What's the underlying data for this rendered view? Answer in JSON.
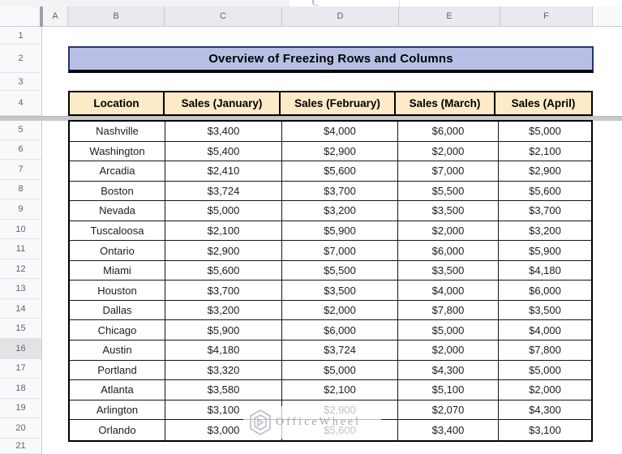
{
  "sheet": {
    "column_headers": [
      "A",
      "B",
      "C",
      "D",
      "E",
      "F"
    ],
    "row_numbers": [
      "1",
      "2",
      "3",
      "4",
      "5",
      "6",
      "7",
      "8",
      "9",
      "10",
      "11",
      "12",
      "13",
      "14",
      "15",
      "16",
      "17",
      "18",
      "19",
      "20",
      "21"
    ],
    "active_row": "16",
    "title": "Overview of Freezing Rows and Columns",
    "table": {
      "headers": [
        "Location",
        "Sales (January)",
        "Sales (February)",
        "Sales (March)",
        "Sales (April)"
      ],
      "rows": [
        [
          "Nashville",
          "$3,400",
          "$4,000",
          "$6,000",
          "$5,000"
        ],
        [
          "Washington",
          "$5,400",
          "$2,900",
          "$2,000",
          "$2,100"
        ],
        [
          "Arcadia",
          "$2,410",
          "$5,600",
          "$7,000",
          "$2,900"
        ],
        [
          "Boston",
          "$3,724",
          "$3,700",
          "$5,500",
          "$5,600"
        ],
        [
          "Nevada",
          "$5,000",
          "$3,200",
          "$3,500",
          "$3,700"
        ],
        [
          "Tuscaloosa",
          "$2,100",
          "$5,900",
          "$2,000",
          "$3,200"
        ],
        [
          "Ontario",
          "$2,900",
          "$7,000",
          "$6,000",
          "$5,900"
        ],
        [
          "Miami",
          "$5,600",
          "$5,500",
          "$3,500",
          "$4,180"
        ],
        [
          "Houston",
          "$3,700",
          "$3,500",
          "$4,000",
          "$6,000"
        ],
        [
          "Dallas",
          "$3,200",
          "$2,000",
          "$7,800",
          "$3,500"
        ],
        [
          "Chicago",
          "$5,900",
          "$6,000",
          "$5,000",
          "$4,000"
        ],
        [
          "Austin",
          "$4,180",
          "$3,724",
          "$2,000",
          "$7,800"
        ],
        [
          "Portland",
          "$3,320",
          "$5,000",
          "$4,300",
          "$5,000"
        ],
        [
          "Atlanta",
          "$3,580",
          "$2,100",
          "$5,100",
          "$2,000"
        ],
        [
          "Arlington",
          "$3,100",
          "$2,900",
          "$2,070",
          "$4,300"
        ],
        [
          "Orlando",
          "$3,000",
          "$5,600",
          "$3,400",
          "$3,100"
        ]
      ]
    },
    "watermark": "OfficeWheel",
    "colors": {
      "title_bg": "#b7c0e4",
      "title_border": "#27346b",
      "table_header_bg": "#fdeac6",
      "table_border": "#000000",
      "frozen_divider": "#c6c8c9",
      "gutter_bg": "#f8f9fa",
      "gutter_active_bg": "#e2e3e5",
      "header_strip_bg": "#e8eaed",
      "gutter_text": "#5f6368",
      "watermark_text": "#93a0ae"
    }
  }
}
